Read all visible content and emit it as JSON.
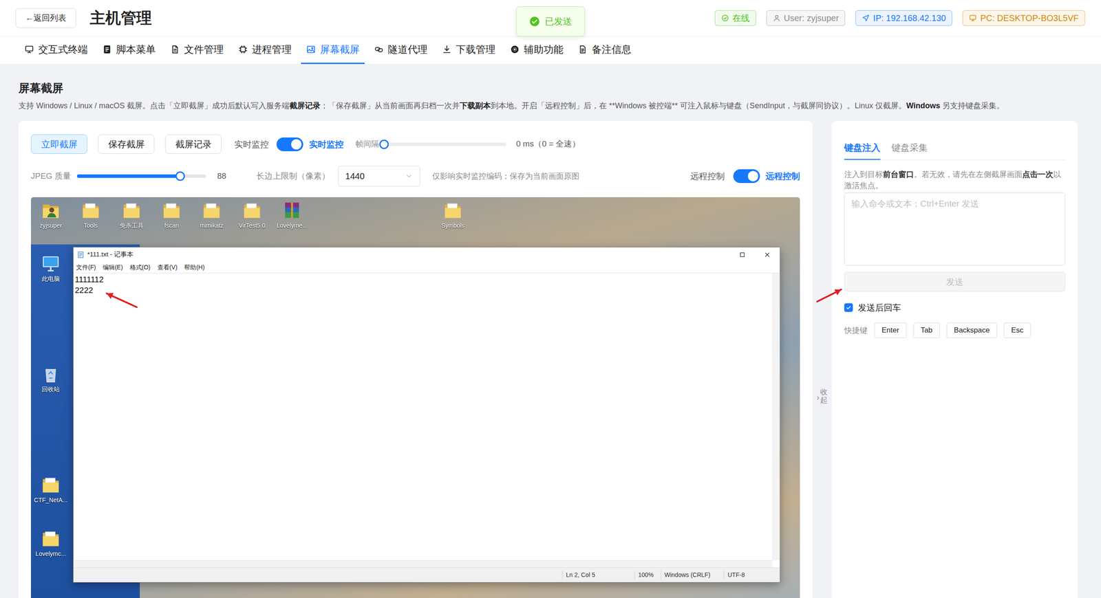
{
  "header": {
    "back_button": "←返回列表",
    "title": "主机管理",
    "badges": [
      {
        "text": "在线",
        "kind": "check",
        "color": "#52c41a"
      },
      {
        "text": "User: zyjsuper",
        "kind": "user",
        "color": "#8c8c8c"
      },
      {
        "text": "IP: 192.168.42.130",
        "kind": "location",
        "color": "#1677ff"
      },
      {
        "text": "PC: DESKTOP-BO3L5VF",
        "kind": "monitor",
        "color": "#d48806"
      }
    ]
  },
  "toast": {
    "text": "已发送"
  },
  "tabs": [
    {
      "label": "交互式终端",
      "kind": "monitor",
      "selected": false
    },
    {
      "label": "脚本菜单",
      "kind": "script",
      "selected": false
    },
    {
      "label": "文件管理",
      "kind": "file",
      "selected": false
    },
    {
      "label": "进程管理",
      "kind": "chip",
      "selected": false
    },
    {
      "label": "屏幕截屏",
      "kind": "image",
      "selected": true
    },
    {
      "label": "隧道代理",
      "kind": "link",
      "selected": false
    },
    {
      "label": "下载管理",
      "kind": "download",
      "selected": false
    },
    {
      "label": "辅助功能",
      "kind": "gear",
      "selected": false
    },
    {
      "label": "备注信息",
      "kind": "notes",
      "selected": false
    }
  ],
  "section": {
    "title": "屏幕截屏",
    "description": [
      {
        "text": "支持 Windows / Linux / macOS 截屏。点击「立即截屏」成功后默认写入服务端",
        "bold": false
      },
      {
        "text": "截屏记录",
        "bold": true
      },
      {
        "text": "；「保存截屏」从当前画面再归档一次并",
        "bold": false
      },
      {
        "text": "下载副本",
        "bold": true
      },
      {
        "text": "到本地。开启「远程控制」后，在 **Windows 被控端** 可注入鼠标与键盘（SendInput，与截屏同协议）。Linux 仅截屏。",
        "bold": false
      },
      {
        "text": "Windows",
        "bold": true
      },
      {
        "text": " 另支持键盘采集。",
        "bold": false
      }
    ]
  },
  "toolbar": {
    "buttons": [
      {
        "label": "立即截屏",
        "selected": true
      },
      {
        "label": "保存截屏",
        "selected": false
      },
      {
        "label": "截屏记录",
        "selected": false
      }
    ],
    "monitor": {
      "label": "实时监控",
      "on": true,
      "state_text": "实时监控"
    },
    "interval": {
      "label": "帧间隔",
      "level": 0,
      "reading": "0 ms（0 = 全速）"
    },
    "jpeg": {
      "label": "JPEG 质量",
      "level": 0.8,
      "reading": "88"
    },
    "max_edge": {
      "label": "长边上限制（像素）",
      "value": "1440"
    },
    "note": "仅影响实时监控编码；保存为当前画面原图",
    "remote": {
      "label": "远程控制",
      "on": true,
      "state_text": "远程控制"
    }
  },
  "preview": {
    "desktop_icons": [
      {
        "label": "zyjsuper",
        "kind": "user-folder"
      },
      {
        "label": "Tools",
        "kind": "folder"
      },
      {
        "label": "免杀工具",
        "kind": "folder"
      },
      {
        "label": "fscan",
        "kind": "folder"
      },
      {
        "label": "mimikatz",
        "kind": "folder"
      },
      {
        "label": "VirTest5.0",
        "kind": "folder"
      },
      {
        "label": "Lovelyme...",
        "kind": "winrar"
      },
      {
        "label": "Symbols",
        "kind": "folder"
      },
      {
        "label": "此电脑",
        "kind": "pc"
      },
      {
        "label": "回收站",
        "kind": "recycle"
      },
      {
        "label": "CTF_NetA...",
        "kind": "folder"
      },
      {
        "label": "Lovelymc...",
        "kind": "folder"
      }
    ],
    "notepad": {
      "title": "*111.txt - 记事本",
      "menu": [
        "文件(F)",
        "编辑(E)",
        "格式(O)",
        "查看(V)",
        "帮助(H)"
      ],
      "lines": [
        "1111112",
        "2222"
      ],
      "status": [
        "Ln 2, Col 5",
        "100%",
        "Windows (CRLF)",
        "UTF-8"
      ]
    }
  },
  "collapse": {
    "arrow": "›",
    "label": "收起"
  },
  "side_panel": {
    "tabs": [
      {
        "label": "键盘注入",
        "selected": true
      },
      {
        "label": "键盘采集",
        "selected": false
      }
    ],
    "hint": [
      {
        "text": "注入到目标",
        "bold": false
      },
      {
        "text": "前台窗口",
        "bold": true
      },
      {
        "text": "。若无效，请先在左侧截屏画面",
        "bold": false
      },
      {
        "text": "点击一次",
        "bold": true
      },
      {
        "text": "以激活焦点。",
        "bold": false
      }
    ],
    "input": {
      "placeholder": "输入命令或文本；Ctrl+Enter 发送"
    },
    "send_button": {
      "label": "发送",
      "disabled": true
    },
    "enter_after_send": {
      "label": "发送后回车",
      "checked": true
    },
    "shortcuts": {
      "label": "快捷键",
      "keys": [
        "Enter",
        "Tab",
        "Backspace",
        "Esc"
      ]
    }
  }
}
